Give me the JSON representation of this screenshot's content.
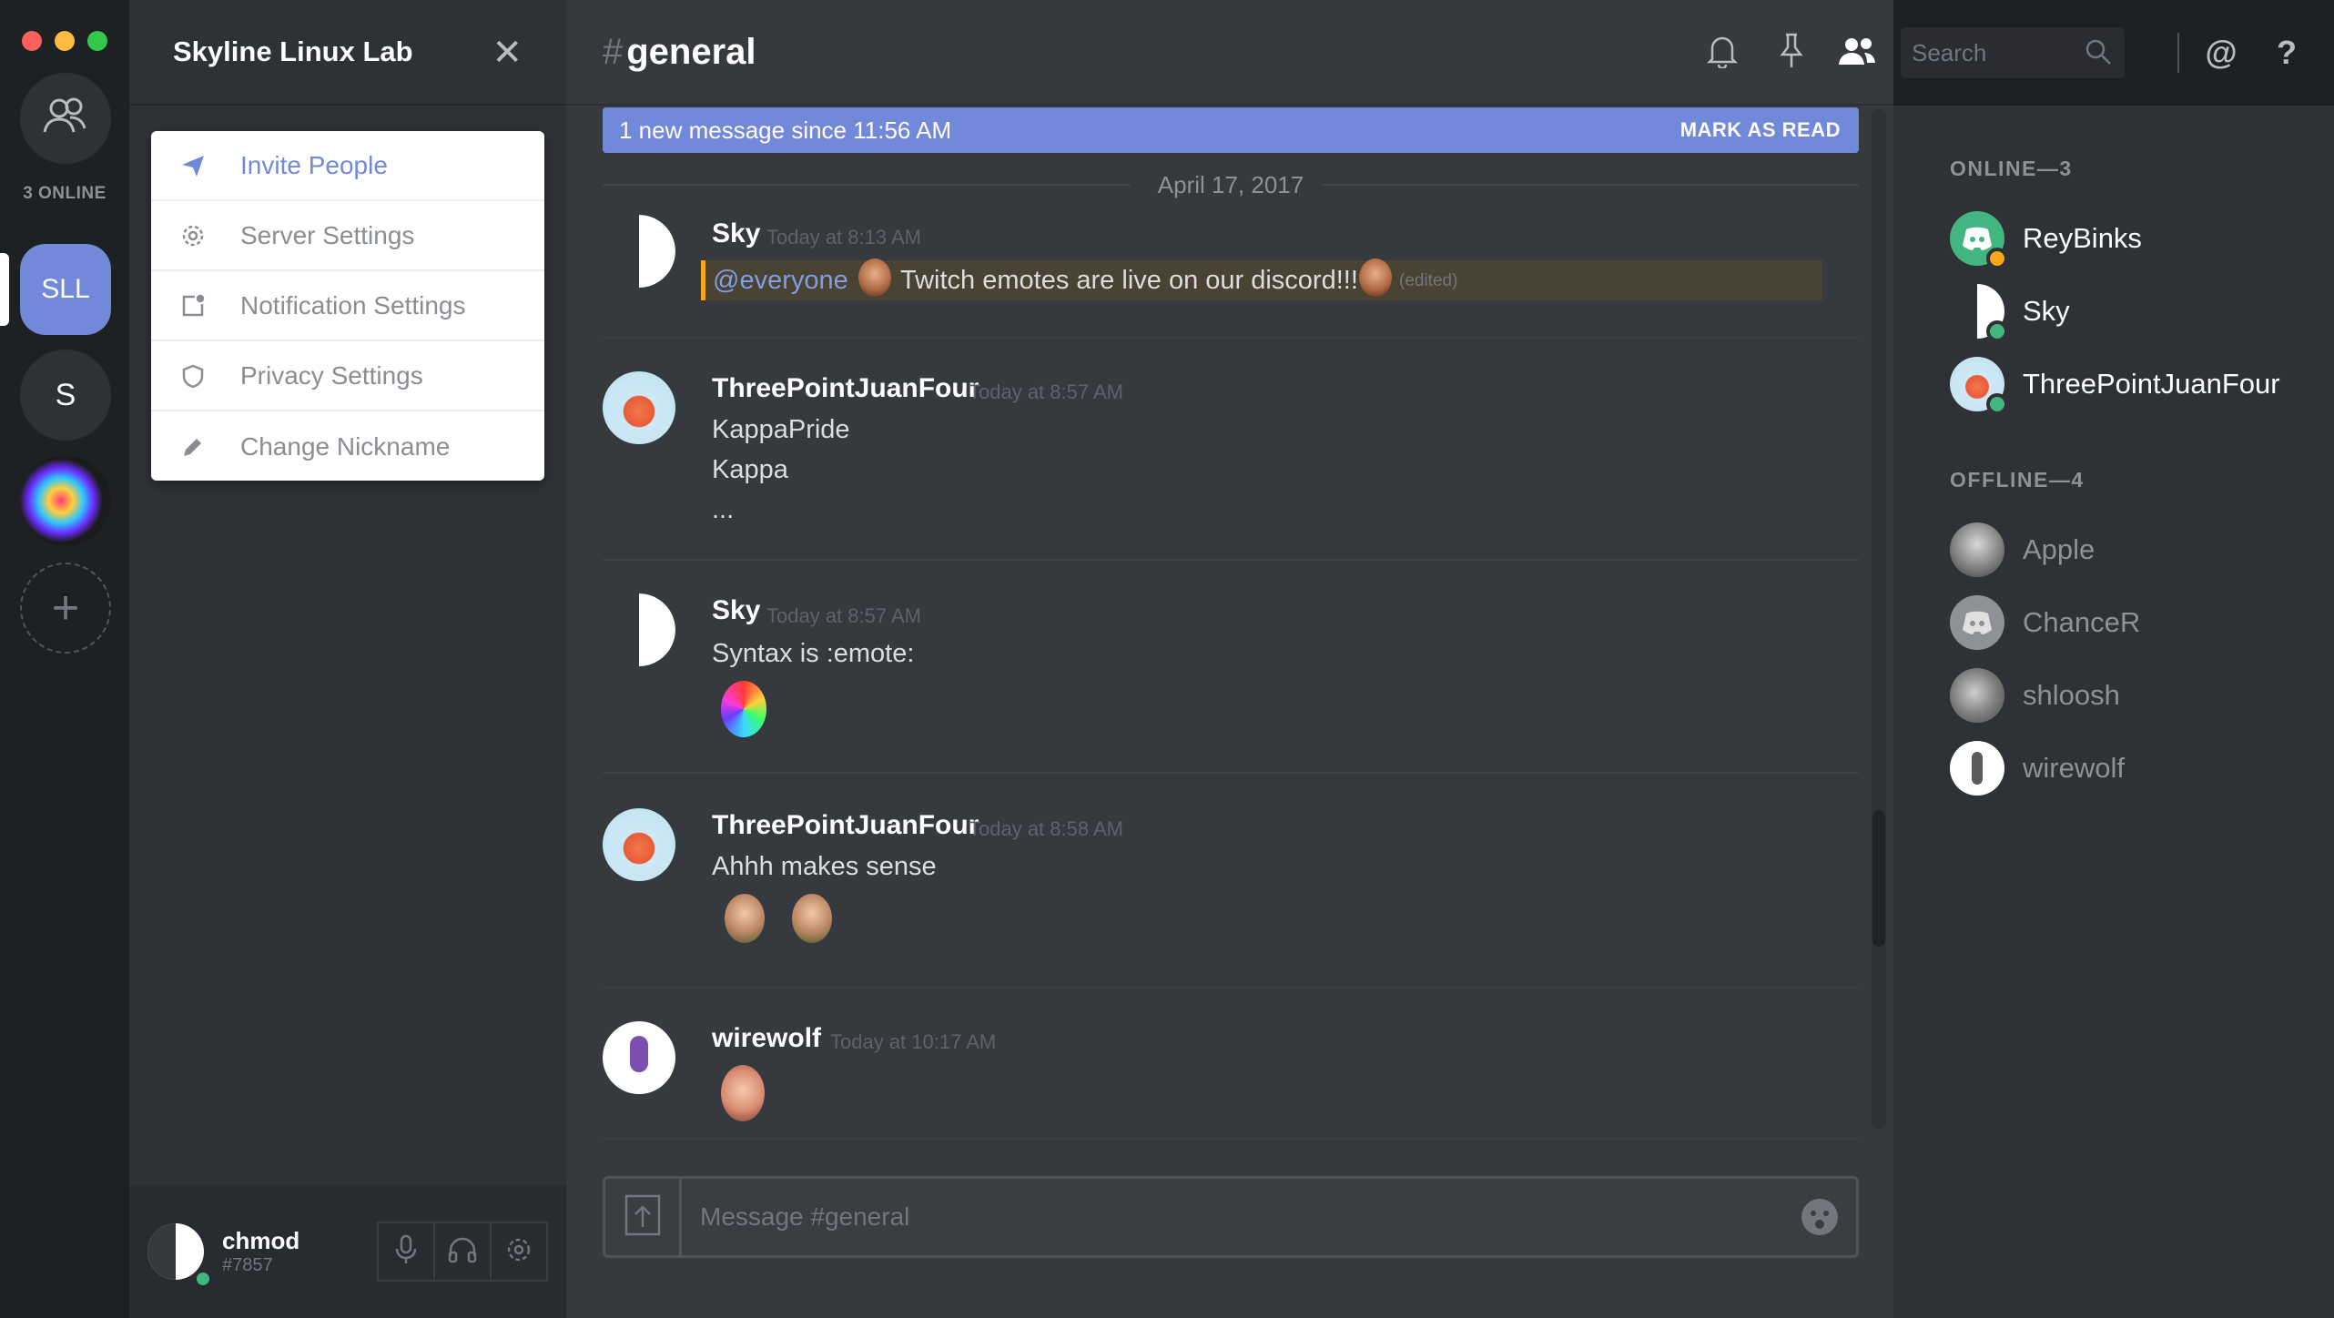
{
  "server_rail": {
    "online_count": "3 ONLINE",
    "servers": [
      {
        "label": "SLL",
        "color": "#7289da",
        "active": true
      },
      {
        "label": "S",
        "color": "#2e3136"
      },
      {
        "label": "",
        "color": "#1b1b1b"
      }
    ],
    "add_label": "+"
  },
  "channel_panel": {
    "server_name": "Skyline Linux Lab",
    "close_glyph": "✕",
    "menu": [
      {
        "label": "Invite People",
        "icon": "send-icon"
      },
      {
        "label": "Server Settings",
        "icon": "gear-icon"
      },
      {
        "label": "Notification Settings",
        "icon": "notification-icon"
      },
      {
        "label": "Privacy Settings",
        "icon": "shield-icon"
      },
      {
        "label": "Change Nickname",
        "icon": "pencil-icon"
      }
    ],
    "user": {
      "name": "chmod",
      "tag": "#7857"
    }
  },
  "topbar": {
    "hash": "#",
    "channel": "general",
    "search_placeholder": "Search"
  },
  "banner": {
    "text": "1 new message since 11:56 AM",
    "action": "MARK AS READ"
  },
  "date_divider": "April 17, 2017",
  "messages": [
    {
      "author": "Sky",
      "time": "Today at 8:13 AM",
      "mention": "@everyone",
      "text": "Twitch emotes are live on our discord!!!",
      "edited": "(edited)"
    },
    {
      "author": "ThreePointJuanFour",
      "time": "Today at 8:57 AM",
      "lines": [
        "KappaPride",
        "Kappa",
        "..."
      ]
    },
    {
      "author": "Sky",
      "time": "Today at 8:57 AM",
      "lines": [
        "Syntax is :emote:"
      ]
    },
    {
      "author": "ThreePointJuanFour",
      "time": "Today at 8:58 AM",
      "lines": [
        "Ahhh makes sense"
      ]
    },
    {
      "author": "wirewolf",
      "time": "Today at 10:17 AM",
      "lines": []
    }
  ],
  "composer": {
    "placeholder": "Message #general"
  },
  "members": {
    "online_header": "ONLINE—3",
    "offline_header": "OFFLINE—4",
    "online": [
      {
        "name": "ReyBinks",
        "status_color": "#faa61a"
      },
      {
        "name": "Sky",
        "status_color": "#43b581"
      },
      {
        "name": "ThreePointJuanFour",
        "status_color": "#43b581"
      }
    ],
    "offline": [
      {
        "name": "Apple"
      },
      {
        "name": "ChanceR"
      },
      {
        "name": "shloosh"
      },
      {
        "name": "wirewolf"
      }
    ]
  },
  "colors": {
    "accent": "#7289da",
    "online": "#43b581",
    "idle": "#faa61a",
    "mention_bg": "#4a4232"
  }
}
